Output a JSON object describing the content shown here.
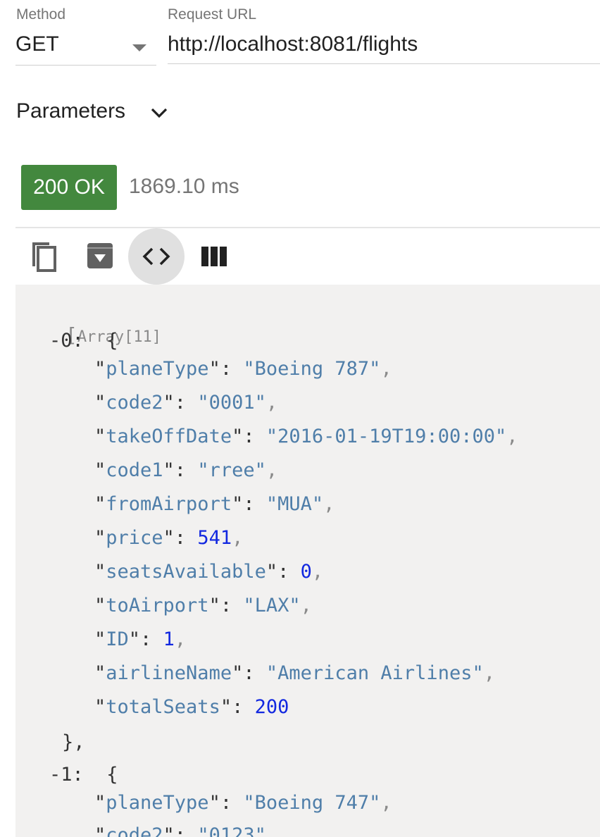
{
  "request": {
    "method_label": "Method",
    "method_value": "GET",
    "url_label": "Request URL",
    "url_value": "http://localhost:8081/flights"
  },
  "parameters": {
    "label": "Parameters",
    "icon": "chevron-down-icon"
  },
  "response": {
    "status": "200 OK",
    "status_color": "#43883e",
    "time": "1869.10 ms"
  },
  "toolbar": {
    "icons": [
      "copy-icon",
      "download-icon",
      "code-icon",
      "columns-icon"
    ]
  },
  "body": {
    "array_label": "Array[11]",
    "items": [
      {
        "index": "-0:",
        "fields": [
          {
            "key": "planeType",
            "value": "\"Boeing 787\"",
            "type": "string"
          },
          {
            "key": "code2",
            "value": "\"0001\"",
            "type": "string"
          },
          {
            "key": "takeOffDate",
            "value": "\"2016-01-19T19:00:00\"",
            "type": "string"
          },
          {
            "key": "code1",
            "value": "\"rree\"",
            "type": "string"
          },
          {
            "key": "fromAirport",
            "value": "\"MUA\"",
            "type": "string"
          },
          {
            "key": "price",
            "value": "541",
            "type": "number"
          },
          {
            "key": "seatsAvailable",
            "value": "0",
            "type": "number"
          },
          {
            "key": "toAirport",
            "value": "\"LAX\"",
            "type": "string"
          },
          {
            "key": "ID",
            "value": "1",
            "type": "number"
          },
          {
            "key": "airlineName",
            "value": "\"American Airlines\"",
            "type": "string"
          },
          {
            "key": "totalSeats",
            "value": "200",
            "type": "number"
          }
        ]
      },
      {
        "index": "-1:",
        "fields": [
          {
            "key": "planeType",
            "value": "\"Boeing 747\"",
            "type": "string"
          },
          {
            "key": "code2",
            "value": "\"0123\"",
            "type": "string"
          }
        ]
      }
    ]
  },
  "colors": {
    "key": "#4f7ea9",
    "string": "#4f7ea9",
    "number": "#1228e0",
    "panel": "#f2f1f0"
  }
}
